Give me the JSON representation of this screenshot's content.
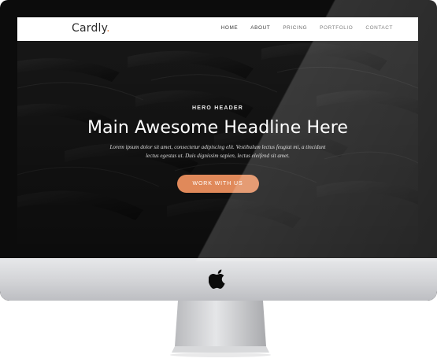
{
  "site": {
    "brand": "Cardly",
    "brand_dot": "."
  },
  "nav": {
    "items": [
      {
        "label": "HOME"
      },
      {
        "label": "ABOUT"
      },
      {
        "label": "PRICING"
      },
      {
        "label": "PORTFOLIO"
      },
      {
        "label": "CONTACT"
      }
    ]
  },
  "hero": {
    "eyebrow": "HERO HEADER",
    "headline": "Main Awesome Headline Here",
    "subtext": "Lorem ipsum dolor sit amet, consectetur adipiscing elit. Vestibulum lectus feugiat mi, a tincidunt lectus egestas ut. Duis dignissim sapien, lectus eleifend sit amet.",
    "cta_label": "WORK WITH US"
  },
  "colors": {
    "accent": "#e0895a",
    "hero_background": "#1d1d1d",
    "navbar": "#ffffff"
  },
  "icons": {
    "brand_mark": "apple-logo-icon"
  }
}
